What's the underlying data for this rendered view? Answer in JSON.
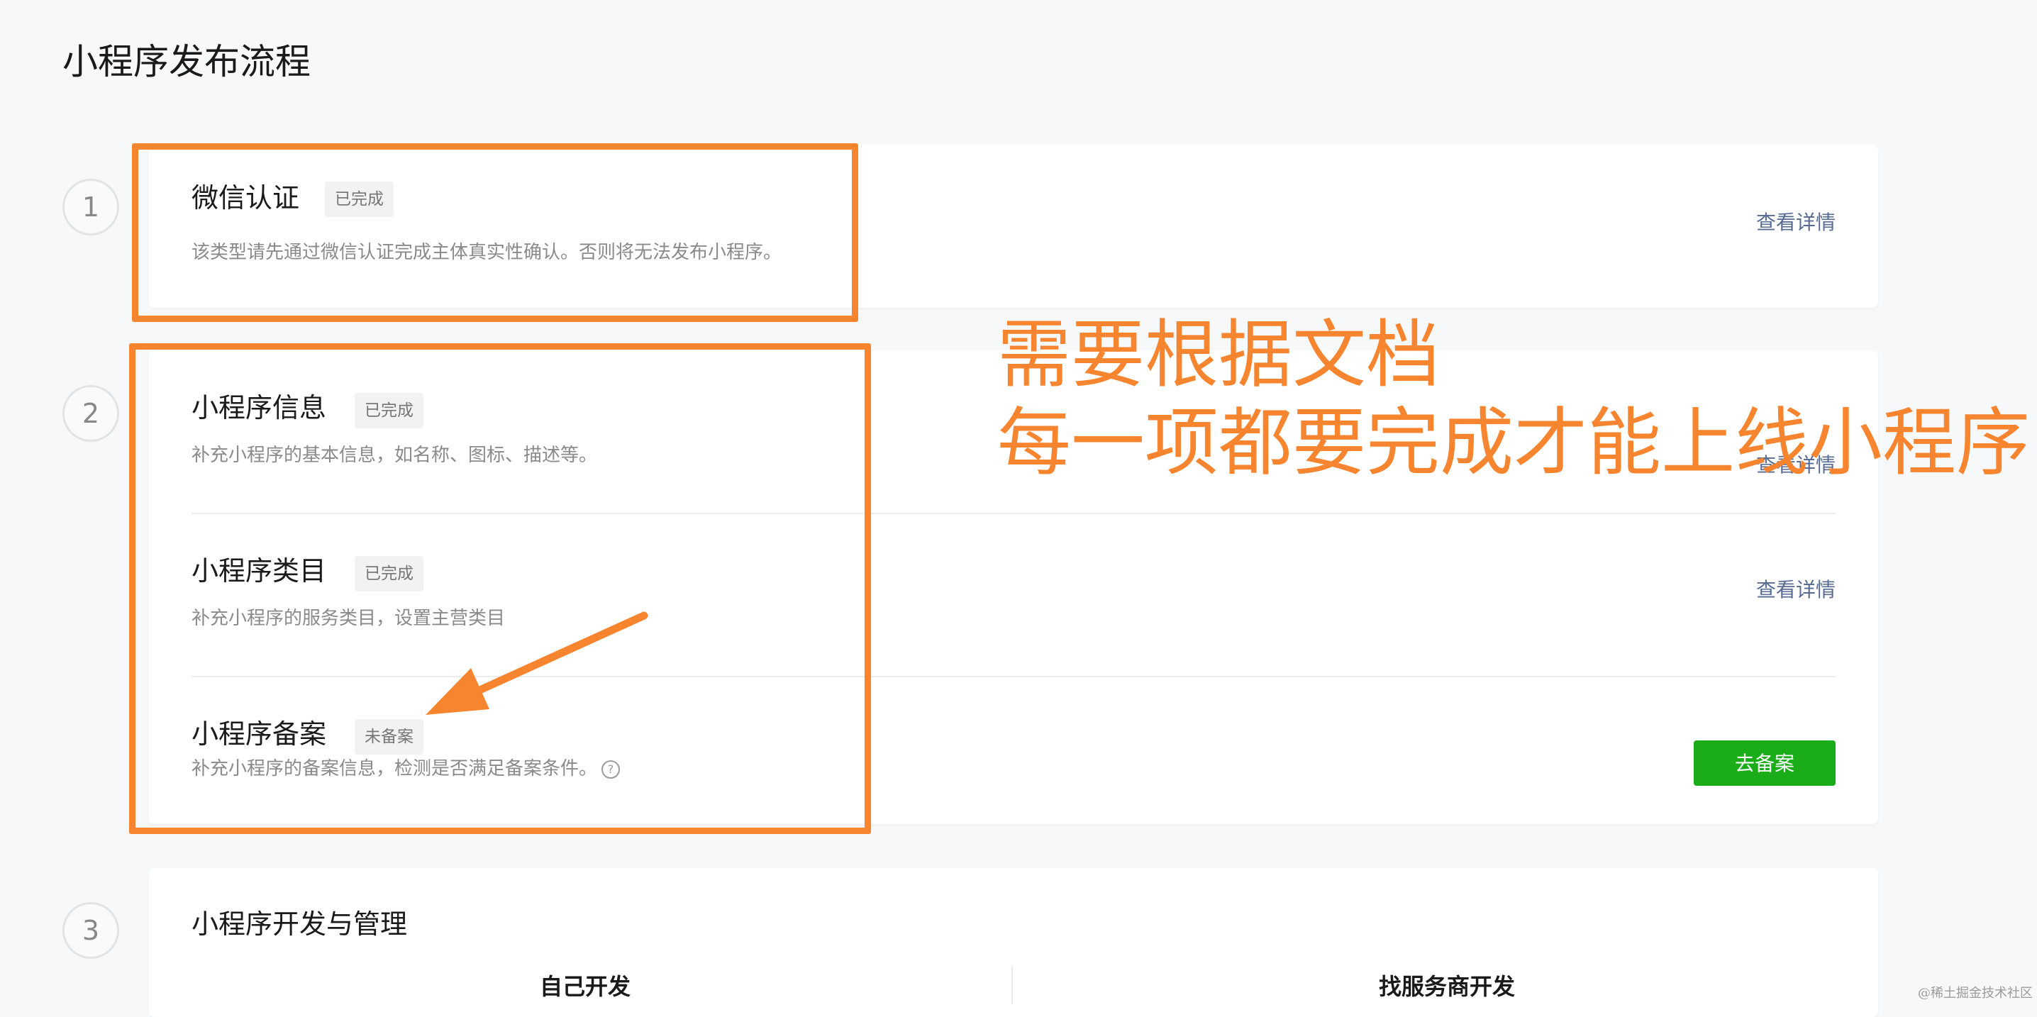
{
  "page": {
    "title": "小程序发布流程"
  },
  "steps": [
    {
      "number": "1"
    },
    {
      "number": "2"
    },
    {
      "number": "3"
    }
  ],
  "wechat_auth": {
    "title": "微信认证",
    "status": "已完成",
    "description": "该类型请先通过微信认证完成主体真实性确认。否则将无法发布小程序。",
    "link": "查看详情"
  },
  "miniprogram_info": {
    "title": "小程序信息",
    "status": "已完成",
    "description": "补充小程序的基本信息，如名称、图标、描述等。",
    "link": "查看详情"
  },
  "miniprogram_category": {
    "title": "小程序类目",
    "status": "已完成",
    "description": "补充小程序的服务类目，设置主营类目",
    "link": "查看详情"
  },
  "miniprogram_filing": {
    "title": "小程序备案",
    "status": "未备案",
    "description": "补充小程序的备案信息，检测是否满足备案条件。",
    "button": "去备案",
    "help_icon": "question-circle-icon"
  },
  "dev_management": {
    "title": "小程序开发与管理",
    "option_self": "自己开发",
    "option_vendor": "找服务商开发"
  },
  "annotation": {
    "line1": "需要根据文档",
    "line2": "每一项都要完成才能上线小程序"
  },
  "watermark": "@稀土掘金技术社区",
  "colors": {
    "annotation": "#f7852f",
    "primary_button": "#1aad19",
    "link": "#576b95",
    "background": "#f7f8fa"
  }
}
